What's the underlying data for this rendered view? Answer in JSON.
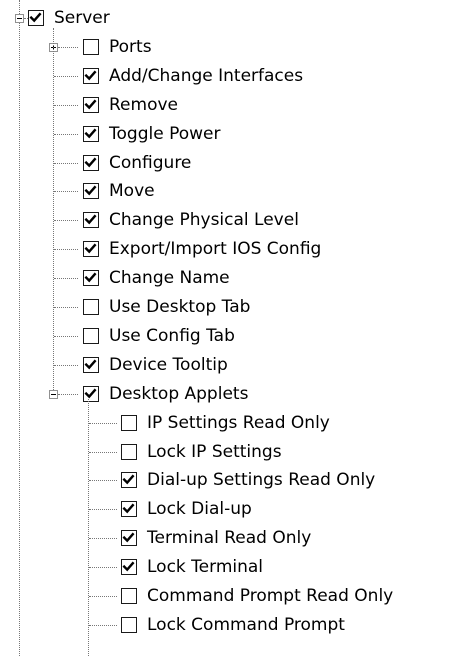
{
  "tree": {
    "root": {
      "label": "Server",
      "checked": true,
      "expanded": true
    },
    "children": [
      {
        "label": "Ports",
        "checked": false,
        "collapsed": true
      },
      {
        "label": "Add/Change Interfaces",
        "checked": true
      },
      {
        "label": "Remove",
        "checked": true
      },
      {
        "label": "Toggle Power",
        "checked": true
      },
      {
        "label": "Configure",
        "checked": true
      },
      {
        "label": "Move",
        "checked": true
      },
      {
        "label": "Change Physical Level",
        "checked": true
      },
      {
        "label": "Export/Import IOS Config",
        "checked": true
      },
      {
        "label": "Change Name",
        "checked": true
      },
      {
        "label": "Use Desktop Tab",
        "checked": false
      },
      {
        "label": "Use Config Tab",
        "checked": false
      },
      {
        "label": "Device Tooltip",
        "checked": true
      },
      {
        "label": "Desktop Applets",
        "checked": true,
        "expanded": true
      }
    ],
    "applets": [
      {
        "label": "IP Settings Read Only",
        "checked": false
      },
      {
        "label": "Lock IP Settings",
        "checked": false
      },
      {
        "label": "Dial-up Settings Read Only",
        "checked": true
      },
      {
        "label": "Lock Dial-up",
        "checked": true
      },
      {
        "label": "Terminal Read Only",
        "checked": true
      },
      {
        "label": "Lock Terminal",
        "checked": true
      },
      {
        "label": "Command Prompt Read Only",
        "checked": false
      },
      {
        "label": "Lock Command Prompt",
        "checked": false
      }
    ]
  }
}
